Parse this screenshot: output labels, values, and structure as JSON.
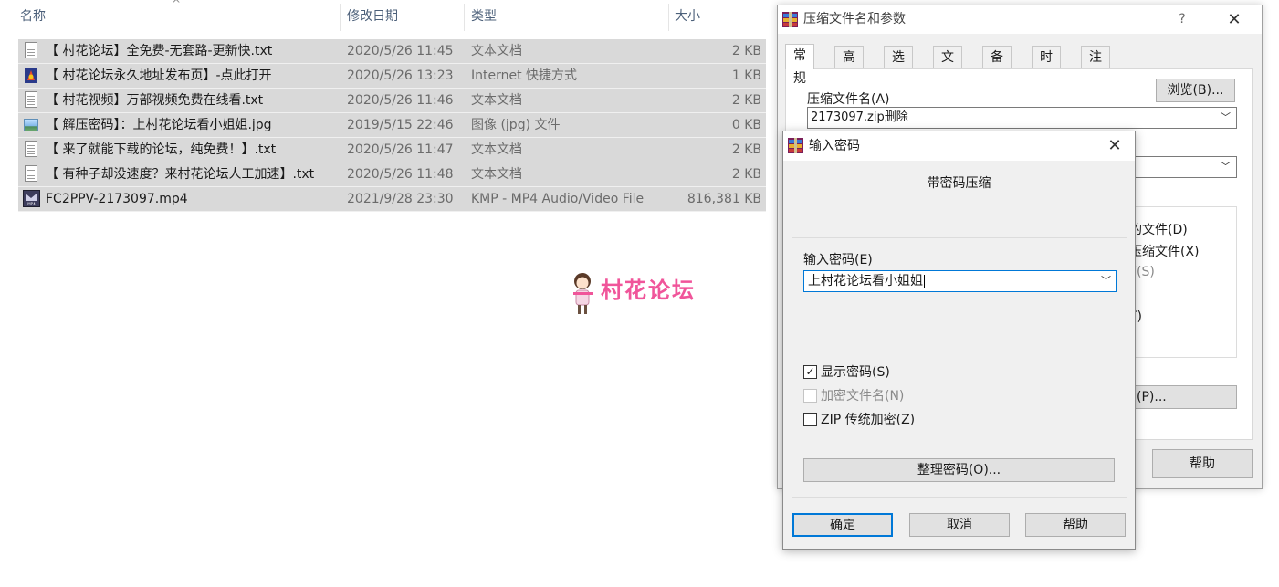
{
  "explorer": {
    "columns": {
      "name": "名称",
      "date": "修改日期",
      "type": "类型",
      "size": "大小"
    },
    "files": [
      {
        "icon": "text-file-icon",
        "name": "【 村花论坛】全免费-无套路-更新快.txt",
        "date": "2020/5/26 11:45",
        "type": "文本文档",
        "size": "2 KB"
      },
      {
        "icon": "internet-shortcut-icon",
        "name": "【 村花论坛永久地址发布页】-点此打开",
        "date": "2020/5/26 13:23",
        "type": "Internet 快捷方式",
        "size": "1 KB"
      },
      {
        "icon": "text-file-icon",
        "name": "【 村花视频】万部视频免费在线看.txt",
        "date": "2020/5/26 11:46",
        "type": "文本文档",
        "size": "2 KB"
      },
      {
        "icon": "image-file-icon",
        "name": "【 解压密码】：上村花论坛看小姐姐.jpg",
        "date": "2019/5/15 22:46",
        "type": "图像 (jpg) 文件",
        "size": "0 KB"
      },
      {
        "icon": "text-file-icon",
        "name": "【 来了就能下载的论坛，纯免费！】.txt",
        "date": "2020/5/26 11:47",
        "type": "文本文档",
        "size": "2 KB"
      },
      {
        "icon": "text-file-icon",
        "name": "【 有种子却没速度？来村花论坛人工加速】.txt",
        "date": "2020/5/26 11:48",
        "type": "文本文档",
        "size": "2 KB"
      },
      {
        "icon": "video-file-icon",
        "name": "FC2PPV-2173097.mp4",
        "date": "2021/9/28 23:30",
        "type": "KMP - MP4 Audio/Video File",
        "size": "816,381 KB"
      }
    ]
  },
  "watermark": {
    "text": "村花论坛",
    "color": "#f0559a"
  },
  "archive_dialog": {
    "title": "压缩文件名和参数",
    "help": "?",
    "close": "✕",
    "tabs": [
      "常规",
      "高级",
      "选项",
      "文件",
      "备份",
      "时间",
      "注释"
    ],
    "archive_name_label": "压缩文件名(A)",
    "browse_label": "浏览(B)...",
    "archive_name_value": "2173097.zip删除",
    "partial_option_1": "的文件(D)",
    "partial_option_2": "压缩文件(X)",
    "partial_option_3": "F(S)",
    "partial_option_4": "T)",
    "password_button_partial": "(P)...",
    "help_button": "帮助"
  },
  "password_dialog": {
    "title": "输入密码",
    "close": "✕",
    "heading": "带密码压缩",
    "password_label": "输入密码(E)",
    "password_value": "上村花论坛看小姐姐",
    "show_password": {
      "label": "显示密码(S)",
      "checked": true
    },
    "encrypt_filenames": {
      "label": "加密文件名(N)",
      "checked": false,
      "disabled": true
    },
    "zip_legacy": {
      "label": "ZIP 传统加密(Z)",
      "checked": false
    },
    "organize_button": "整理密码(O)...",
    "ok_button": "确定",
    "cancel_button": "取消",
    "help_button": "帮助",
    "check_mark": "✓"
  }
}
